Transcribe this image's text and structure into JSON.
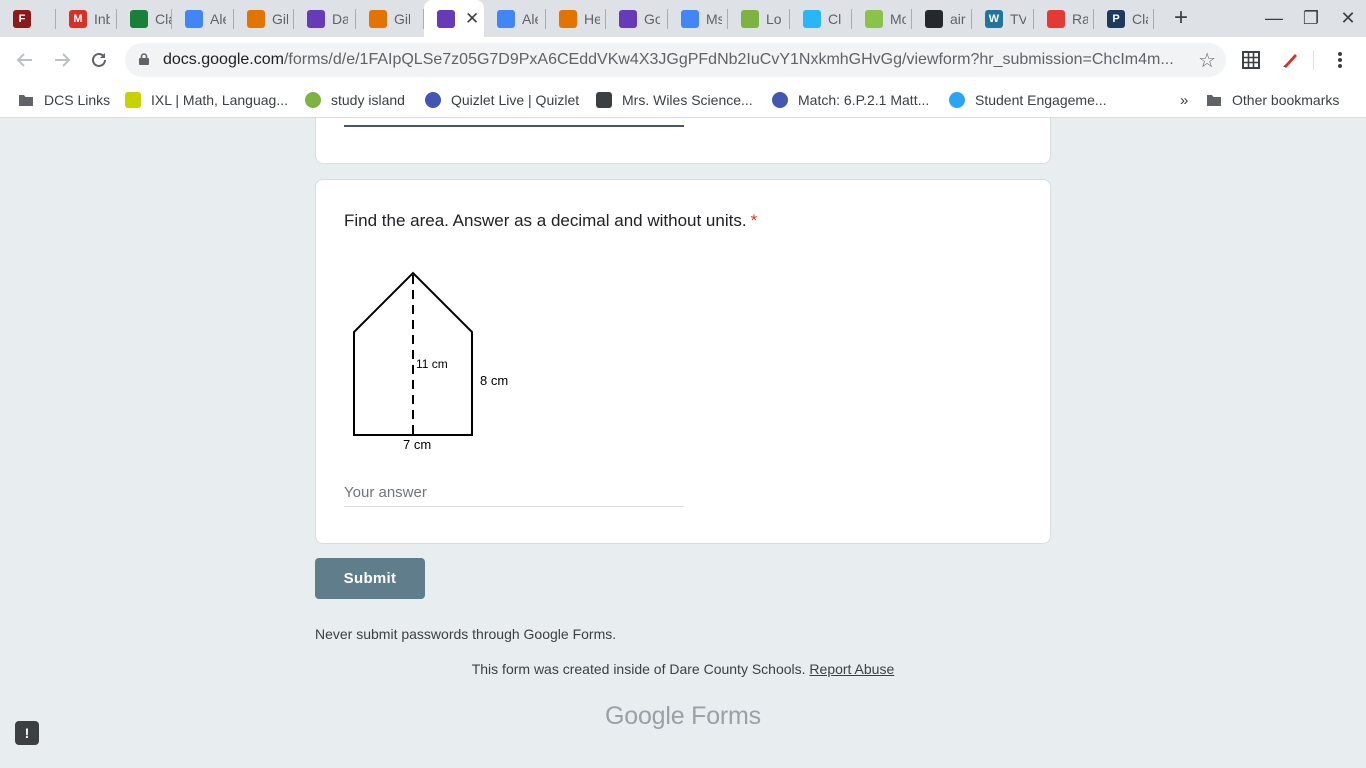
{
  "tabs": [
    {
      "title": "",
      "letter": "F",
      "color": "#8b1a1a"
    },
    {
      "title": "Inbox",
      "letter": "M",
      "color": "#d93025"
    },
    {
      "title": "Classes",
      "letter": "",
      "color": "#188038"
    },
    {
      "title": "Alex",
      "letter": "",
      "color": "#4285f4"
    },
    {
      "title": "Gil",
      "letter": "",
      "color": "#e37400"
    },
    {
      "title": "Da",
      "letter": "",
      "color": "#673ab7"
    },
    {
      "title": "Gil",
      "letter": "",
      "color": "#e37400"
    },
    {
      "title": "",
      "letter": "",
      "color": "#673ab7",
      "active": true
    },
    {
      "title": "Alex",
      "letter": "",
      "color": "#4285f4"
    },
    {
      "title": "He",
      "letter": "",
      "color": "#e37400"
    },
    {
      "title": "Go",
      "letter": "",
      "color": "#673ab7"
    },
    {
      "title": "Ms",
      "letter": "",
      "color": "#4285f4"
    },
    {
      "title": "Lo",
      "letter": "",
      "color": "#7cb342"
    },
    {
      "title": "Cl",
      "letter": "",
      "color": "#29b6f6"
    },
    {
      "title": "Mo",
      "letter": "",
      "color": "#8bc34a"
    },
    {
      "title": "air",
      "letter": "",
      "color": "#24292e"
    },
    {
      "title": "TV",
      "letter": "W",
      "color": "#21759b"
    },
    {
      "title": "Ra",
      "letter": "",
      "color": "#e53935"
    },
    {
      "title": "Cla",
      "letter": "P",
      "color": "#1e3a5f"
    }
  ],
  "window": {
    "minimize": "—",
    "restore": "❐",
    "close": "✕",
    "newtab": "+"
  },
  "address": {
    "domain": "docs.google.com",
    "path": "/forms/d/e/1FAIpQLSe7z05G7D9PxA6CEddVKw4X3JGgPFdNb2IuCvY1NxkmhGHvGg/viewform?hr_submission=ChcIm4m..."
  },
  "bookmarks": [
    {
      "label": "DCS Links",
      "color": "#5f6368"
    },
    {
      "label": "IXL | Math, Languag...",
      "color": "#c6d300"
    },
    {
      "label": "study island",
      "color": "#7cb342"
    },
    {
      "label": "Quizlet Live | Quizlet",
      "color": "#4257b2"
    },
    {
      "label": "Mrs. Wiles Science...",
      "color": "#3c4043"
    },
    {
      "label": "Match: 6.P.2.1 Matt...",
      "color": "#4257b2"
    },
    {
      "label": "Student Engageme...",
      "color": "#2aa5f5"
    },
    {
      "label": "Other bookmarks",
      "color": "#5f6368"
    }
  ],
  "bookmarks_more": "»",
  "question": {
    "title": "Find the area. Answer as a decimal and without units.",
    "required_mark": "*",
    "placeholder": "Your answer",
    "figure": {
      "height_label": "11 cm",
      "side_label": "8 cm",
      "base_label": "7 cm"
    }
  },
  "submit_label": "Submit",
  "password_warning": "Never submit passwords through Google Forms.",
  "footer": {
    "created_text": "This form was created inside of Dare County Schools.",
    "report_link": "Report Abuse",
    "brand": "Google Forms"
  },
  "feedback_icon": "!"
}
